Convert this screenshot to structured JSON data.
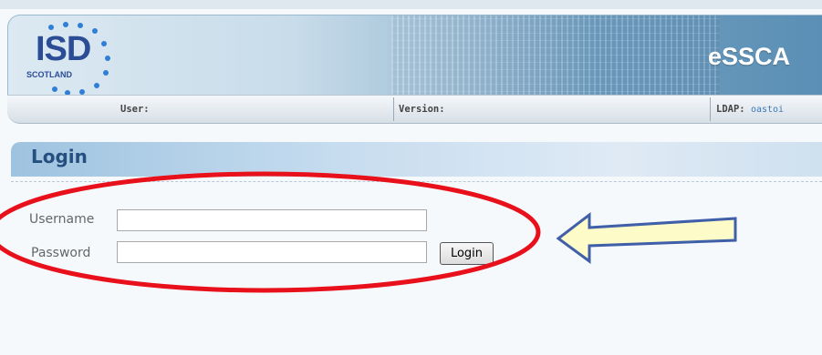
{
  "app": {
    "brand_title": "eSSCA",
    "logo": {
      "wordmark": "ISD",
      "subtitle": "SCOTLAND"
    }
  },
  "infobar": {
    "user_label": "User:",
    "version_label": "Version:",
    "ldap_label": "LDAP:",
    "ldap_value": "oastoi"
  },
  "login": {
    "title": "Login",
    "username_label": "Username",
    "username_value": "",
    "password_label": "Password",
    "password_value": "",
    "button_label": "Login"
  },
  "annotations": {
    "ellipse_color": "#e8101a",
    "arrow_fill": "#fdfbc7",
    "arrow_stroke": "#3f5fa8"
  },
  "colors": {
    "header_title": "#244f7e",
    "accent_blue": "#2a4d96"
  }
}
